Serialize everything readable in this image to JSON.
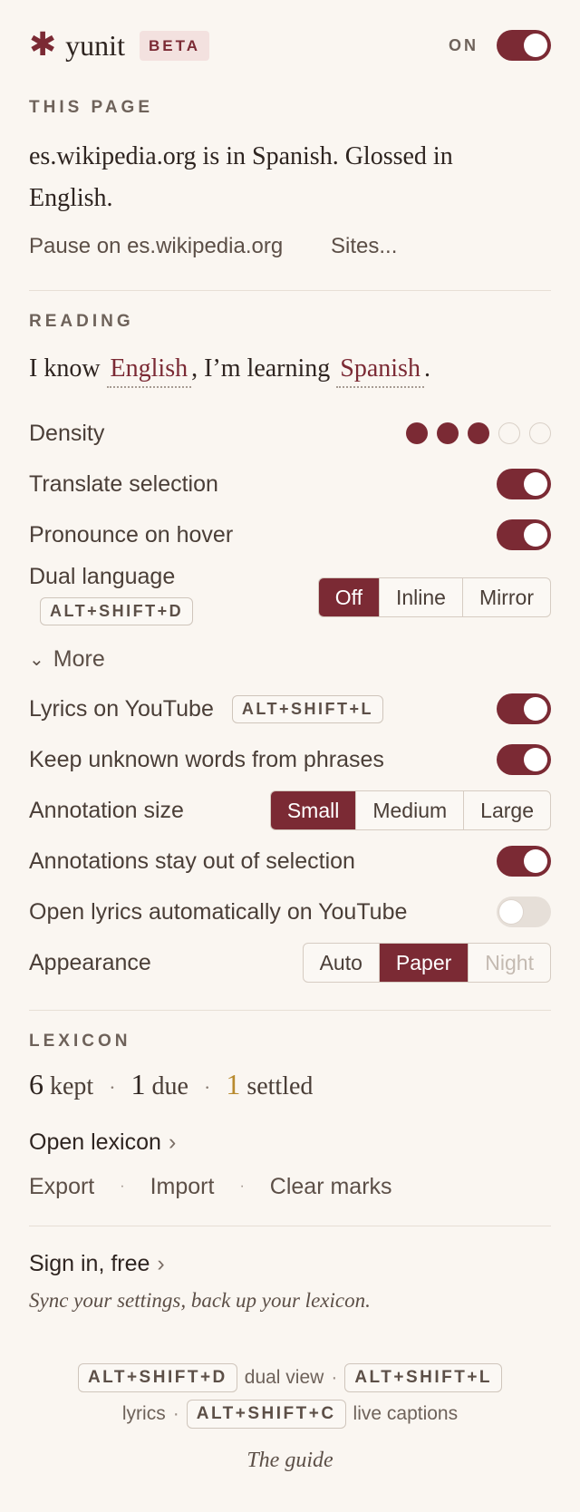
{
  "header": {
    "app_name": "yunit",
    "beta_label": "BETA",
    "on_label": "ON",
    "enabled": true
  },
  "this_page": {
    "section_label": "THIS PAGE",
    "summary": "es.wikipedia.org is in Spanish. Glossed in English.",
    "pause_label": "Pause on es.wikipedia.org",
    "sites_label": "Sites..."
  },
  "reading": {
    "section_label": "READING",
    "know_prefix": "I know",
    "known_language": "English",
    "learning_prefix": ", I’m learning",
    "learning_language": "Spanish",
    "sentence_end": ".",
    "density": {
      "label": "Density",
      "level": 3,
      "max": 5
    },
    "translate_selection": {
      "label": "Translate selection",
      "on": true
    },
    "pronounce_hover": {
      "label": "Pronounce on hover",
      "on": true
    },
    "dual_language": {
      "label": "Dual language",
      "shortcut": "ALT+SHIFT+D",
      "options": [
        "Off",
        "Inline",
        "Mirror"
      ],
      "selected": "Off"
    },
    "more_label": "More",
    "lyrics_youtube": {
      "label": "Lyrics on YouTube",
      "shortcut": "ALT+SHIFT+L",
      "on": true
    },
    "keep_unknown": {
      "label": "Keep unknown words from phrases",
      "on": true
    },
    "annotation_size": {
      "label": "Annotation size",
      "options": [
        "Small",
        "Medium",
        "Large"
      ],
      "selected": "Small"
    },
    "annotations_out": {
      "label": "Annotations stay out of selection",
      "on": true
    },
    "open_lyrics_auto": {
      "label": "Open lyrics automatically on YouTube",
      "on": false
    },
    "appearance": {
      "label": "Appearance",
      "options": [
        "Auto",
        "Paper",
        "Night"
      ],
      "selected": "Paper"
    }
  },
  "lexicon": {
    "section_label": "LEXICON",
    "kept_count": "6",
    "kept_label": "kept",
    "due_count": "1",
    "due_label": "due",
    "settled_count": "1",
    "settled_label": "settled",
    "dot": "·",
    "open_label": "Open lexicon",
    "export_label": "Export",
    "import_label": "Import",
    "clear_label": "Clear marks",
    "gold_color": "#b88a2e"
  },
  "account": {
    "sign_in_label": "Sign in, free",
    "note": "Sync your settings, back up your lexicon."
  },
  "footer": {
    "shortcut_dual": "ALT+SHIFT+D",
    "dual_label": "dual view",
    "shortcut_lyrics": "ALT+SHIFT+L",
    "lyrics_label": "lyrics",
    "shortcut_captions": "ALT+SHIFT+C",
    "captions_label": "live captions",
    "dot": "·",
    "guide_label": "The guide"
  },
  "colors": {
    "accent": "#7b2a34",
    "background": "#faf6f1"
  }
}
